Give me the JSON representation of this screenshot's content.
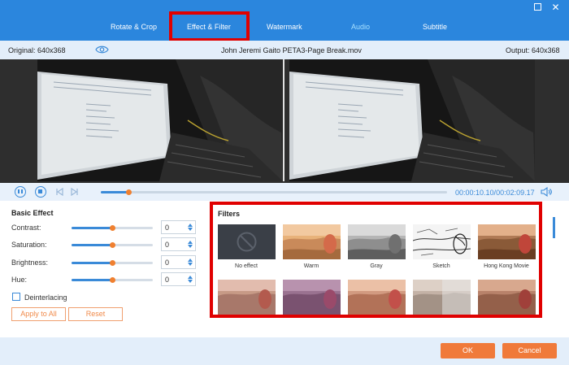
{
  "tabs": [
    {
      "label": "Rotate & Crop"
    },
    {
      "label": "Effect & Filter",
      "active": true
    },
    {
      "label": "Watermark"
    },
    {
      "label": "Audio"
    },
    {
      "label": "Subtitle"
    }
  ],
  "window": {
    "restore_icon": "restore-icon",
    "close_icon": "close-icon"
  },
  "info": {
    "original": "Original: 640x368",
    "filename": "John Jeremi Gaito PETA3-Page Break.mov",
    "output": "Output: 640x368"
  },
  "playback": {
    "current": "00:00:10.10",
    "separator": "/",
    "total": "00:02:09.17",
    "progress_fraction": 0.08
  },
  "basic_effect": {
    "title": "Basic Effect",
    "rows": [
      {
        "label": "Contrast:",
        "value": "0",
        "slider_fraction": 0.5
      },
      {
        "label": "Saturation:",
        "value": "0",
        "slider_fraction": 0.5
      },
      {
        "label": "Brightness:",
        "value": "0",
        "slider_fraction": 0.5
      },
      {
        "label": "Hue:",
        "value": "0",
        "slider_fraction": 0.5
      }
    ],
    "deinterlacing": "Deinterlacing",
    "apply_all": "Apply to All",
    "reset": "Reset"
  },
  "filters": {
    "title": "Filters",
    "items": [
      {
        "label": "No effect"
      },
      {
        "label": "Warm"
      },
      {
        "label": "Gray"
      },
      {
        "label": "Sketch"
      },
      {
        "label": "Hong Kong Movie"
      }
    ]
  },
  "footer": {
    "ok": "OK",
    "cancel": "Cancel"
  },
  "colors": {
    "accent": "#2b86dd",
    "orange": "#f08030",
    "highlight": "#e00000"
  }
}
